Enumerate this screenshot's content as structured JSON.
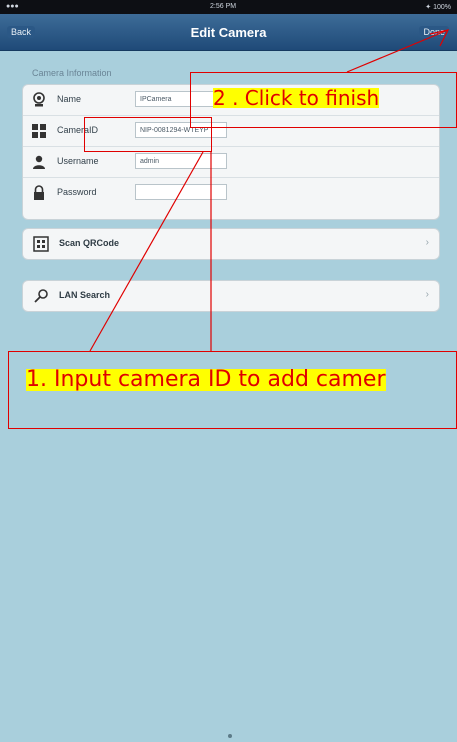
{
  "status_bar": {
    "carrier": "●●●",
    "clock": "2:56 PM",
    "battery": "✦ 100%"
  },
  "nav": {
    "back_label": "Back",
    "title": "Edit Camera",
    "done_label": "Done"
  },
  "camera_info": {
    "section_label": "Camera Information",
    "fields": [
      {
        "label": "Name",
        "value": "IPCamera",
        "icon": "webcam-icon"
      },
      {
        "label": "CameraID",
        "value": "NIP-0081294-WTEYP",
        "icon": "grid-icon"
      },
      {
        "label": "Username",
        "value": "admin",
        "icon": "user-icon"
      },
      {
        "label": "Password",
        "value": "",
        "icon": "lock-icon"
      }
    ]
  },
  "actions": [
    {
      "label": "Scan QRCode",
      "icon": "qrcode-icon"
    },
    {
      "label": "LAN Search",
      "icon": "search-icon"
    }
  ],
  "annotations": {
    "finish": "2 . Click to finish",
    "camera_id": "1. Input camera ID to add camer"
  },
  "colors": {
    "annotation_red": "#e00000",
    "annotation_highlight": "#ffff00",
    "nav_blue": "#1f4a78",
    "background": "#a9cfdc"
  }
}
